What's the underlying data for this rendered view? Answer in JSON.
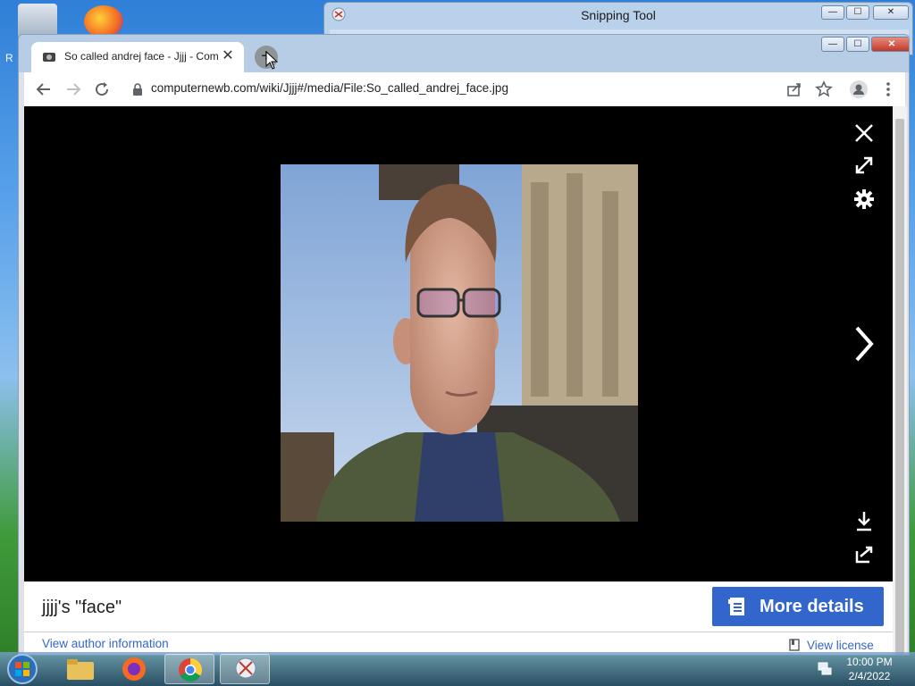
{
  "snipping_tool": {
    "title": "Snipping Tool",
    "min": "—",
    "max": "☐",
    "close": "✕"
  },
  "browser": {
    "tab_title": "So called andrej face - Jjjj - Com",
    "tab_close": "✕",
    "new_tab": "+",
    "url": "computernewb.com/wiki/Jjjj#/media/File:So_called_andrej_face.jpg",
    "win_min": "—",
    "win_max": "☐",
    "win_close": "✕"
  },
  "viewer": {
    "caption": "jjjj's \"face\"",
    "more_details": "More details",
    "author_link": "View author information",
    "license_link": "View license"
  },
  "taskbar": {
    "time": "10:00 PM",
    "date": "2/4/2022"
  },
  "desktop": {
    "partial_label": "R"
  }
}
